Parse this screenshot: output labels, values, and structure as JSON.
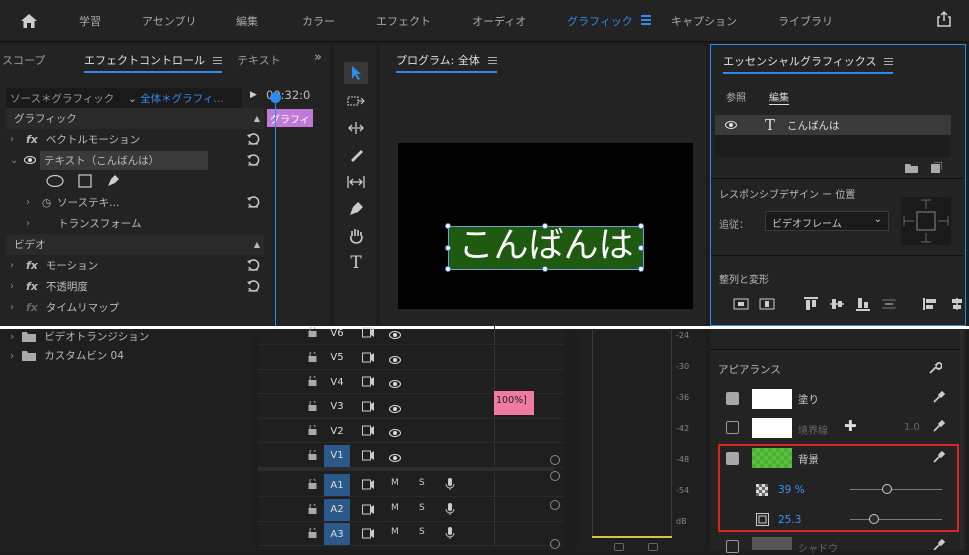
{
  "nav": {
    "tabs": [
      "学習",
      "アセンブリ",
      "編集",
      "カラー",
      "エフェクト",
      "オーディオ",
      "グラフィック",
      "キャプション",
      "ライブラリ"
    ],
    "active": "グラフィック"
  },
  "effect_panel": {
    "tabs": [
      "スコープ",
      "エフェクトコントロール",
      "テキスト"
    ],
    "source_label": "ソース＊グラフィック",
    "seq_label": "全体＊グラフィ…",
    "timecode": "00:32:0",
    "clip_label": "グラフィ",
    "section_graphic": "グラフィック",
    "vector_motion": "ベクトルモーション",
    "text_layer": "テキスト（こんばんは）",
    "source_text": "ソーステキ…",
    "transform": "トランスフォーム",
    "section_video": "ビデオ",
    "motion": "モーション",
    "opacity": "不透明度",
    "time_remap": "タイムリマップ"
  },
  "program": {
    "title": "プログラム: 全体",
    "text": "こんばんは",
    "text_color": "#ffffff",
    "bg_color": "#1e5a10"
  },
  "essential": {
    "title": "エッセンシャルグラフィックス",
    "tabs": [
      "参照",
      "編集"
    ],
    "layer_name": "こんばんは",
    "responsive_title": "レスポンシブデザイン ー 位置",
    "follow_label": "追従：",
    "follow_value": "ビデオフレーム",
    "align_title": "整列と変形",
    "appearance_title": "アピアランス",
    "fill_label": "塗り",
    "stroke_label": "境界線",
    "stroke_value": "1.0",
    "bg_label": "背景",
    "bg_opacity": "39 %",
    "bg_size": "25.3",
    "shadow_label": "シャドウ",
    "bg_swatch": "#4caf36"
  },
  "project": {
    "items": [
      "ビデオトランジション",
      "カスタムビン 04"
    ]
  },
  "timeline": {
    "video_tracks": [
      "V6",
      "V5",
      "V4",
      "V3",
      "V2",
      "V1"
    ],
    "audio_tracks": [
      "A1",
      "A2",
      "A3"
    ],
    "clip_text": "100%]",
    "clip_color": "#f07aa0"
  },
  "meter": {
    "ticks": [
      "-24",
      "-30",
      "-36",
      "-42",
      "-48",
      "-54",
      "dB"
    ]
  }
}
